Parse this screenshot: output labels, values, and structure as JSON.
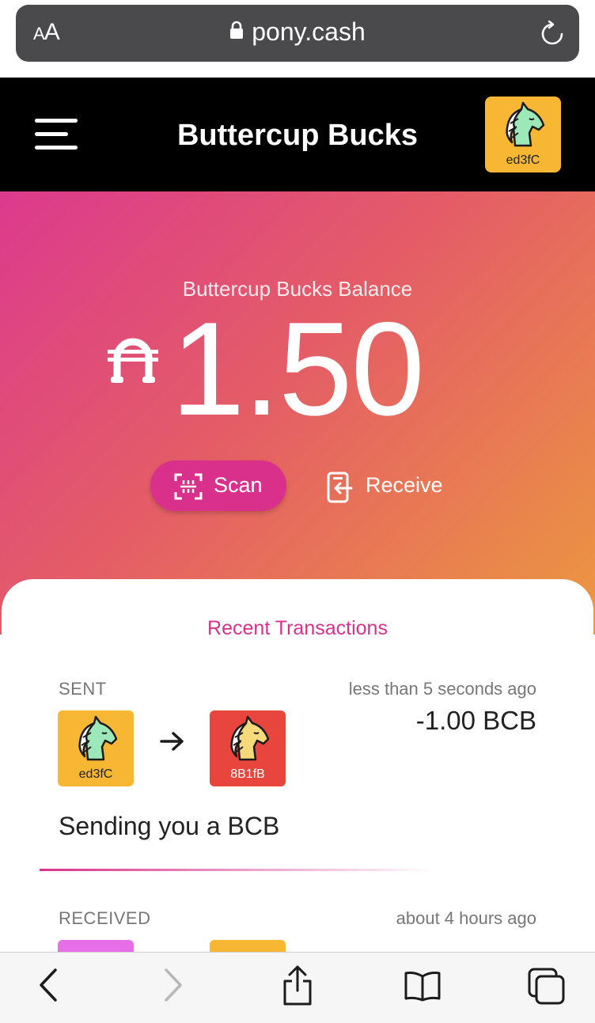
{
  "browser": {
    "text_size_label_small": "A",
    "text_size_label_large": "A",
    "url": "pony.cash"
  },
  "header": {
    "title": "Buttercup Bucks",
    "avatar_label": "ed3fC"
  },
  "balance": {
    "label": "Buttercup Bucks Balance",
    "value": "1.50",
    "scan_label": "Scan",
    "receive_label": "Receive"
  },
  "transactions": {
    "title": "Recent Transactions",
    "items": [
      {
        "type": "SENT",
        "time": "less than 5 seconds ago",
        "from_label": "ed3fC",
        "to_label": "8B1fB",
        "amount": "-1.00 BCB",
        "memo": "Sending you a BCB"
      },
      {
        "type": "RECEIVED",
        "time": "about 4 hours ago"
      }
    ]
  },
  "colors": {
    "accent": "#d9318b",
    "avatar_yellow": "#f7b733",
    "avatar_red": "#e8453c",
    "avatar_pink": "#e66fe8"
  }
}
